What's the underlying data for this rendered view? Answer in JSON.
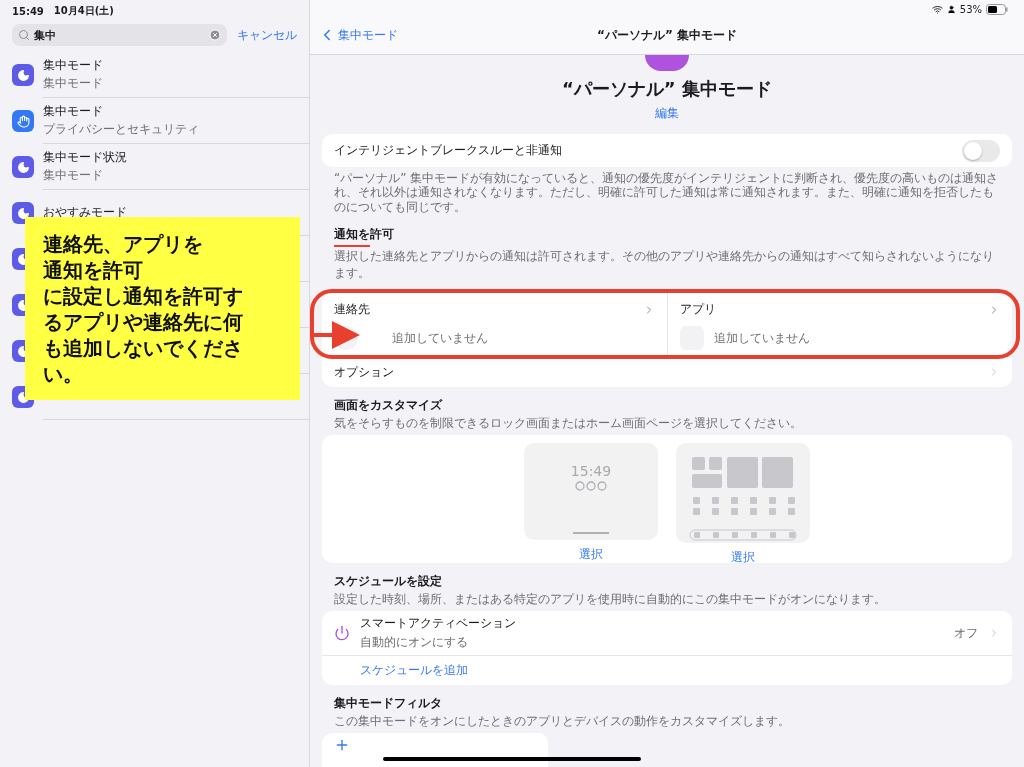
{
  "status_bar": {
    "time": "15:49",
    "date": "10月4日(土)",
    "battery": "53%"
  },
  "sidebar": {
    "search": {
      "value": "集中",
      "cancel": "キャンセル"
    },
    "results": [
      {
        "kind": "focus",
        "title": "集中モード",
        "subtitle": "集中モード"
      },
      {
        "kind": "privacy",
        "title": "集中モード",
        "subtitle": "プライバシーとセキュリティ"
      },
      {
        "kind": "focus",
        "title": "集中モード状況",
        "subtitle": "集中モード"
      },
      {
        "kind": "focus",
        "title": "おやすみモード"
      },
      {
        "kind": "focus"
      },
      {
        "kind": "focus"
      },
      {
        "kind": "focus"
      },
      {
        "kind": "focus"
      }
    ]
  },
  "nav": {
    "back": "集中モード",
    "title": "“パーソナル” 集中モード"
  },
  "header": {
    "title": "“パーソナル” 集中モード",
    "edit": "編集"
  },
  "breakthrough": {
    "label": "インテリジェントブレークスルーと非通知",
    "on": false,
    "footer": "“パーソナル” 集中モードが有効になっていると、通知の優先度がインテリジェントに判断され、優先度の高いものは通知され、それ以外は通知されなくなります。ただし、明確に許可した通知は常に通知されます。また、明確に通知を拒否したものについても同じです。"
  },
  "allow": {
    "title": "通知を許可",
    "subtitle": "選択した連絡先とアプリからの通知は許可されます。その他のアプリや連絡先からの通知はすべて知らされないようになります。",
    "columns": [
      {
        "kind": "contact",
        "label": "連絡先",
        "empty": "追加していません"
      },
      {
        "kind": "app",
        "label": "アプリ",
        "empty": "追加していません"
      }
    ],
    "options": "オプション"
  },
  "customize": {
    "title": "画面をカスタマイズ",
    "subtitle": "気をそらすものを制限できるロック画面またはホーム画面ページを選択してください。",
    "previews": [
      {
        "kind": "lock",
        "time": "15:49",
        "action": "選択"
      },
      {
        "kind": "home",
        "action": "選択"
      }
    ]
  },
  "schedule": {
    "title": "スケジュールを設定",
    "subtitle": "設定した時刻、場所、またはある特定のアプリを使用時に自動的にこの集中モードがオンになります。",
    "items": [
      {
        "title": "スマートアクティベーション",
        "subtitle": "自動的にオンにする",
        "value": "オフ"
      }
    ],
    "add": "スケジュールを追加"
  },
  "filters": {
    "title": "集中モードフィルタ",
    "subtitle": "この集中モードをオンにしたときのアプリとデバイスの動作をカスタマイズします。"
  },
  "annotation": {
    "lines": [
      "連絡先、アプリを",
      "通知を許可",
      "に設定し通知を許可するアプリや連絡先に何も追加しないでください。"
    ]
  }
}
